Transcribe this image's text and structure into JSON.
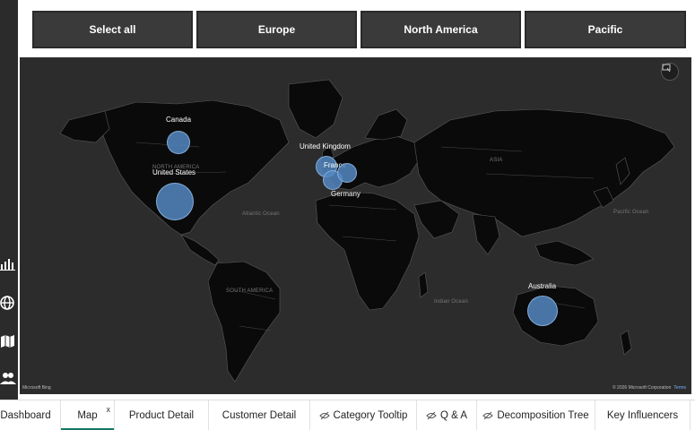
{
  "slicer": {
    "buttons": [
      "Select all",
      "Europe",
      "North America",
      "Pacific"
    ]
  },
  "map": {
    "bubbles": [
      {
        "label": "Canada"
      },
      {
        "label": "United States"
      },
      {
        "label": "United Kingdom"
      },
      {
        "label": "France"
      },
      {
        "label": "Germany"
      },
      {
        "label": "Australia"
      }
    ],
    "regions": {
      "north_america": "NORTH AMERICA",
      "atlantic": "Atlantic Ocean",
      "asia": "ASIA",
      "pacific": "Pacific Ocean",
      "south_america": "SOUTH AMERICA",
      "indian": "Indian Ocean"
    },
    "attribution_left": "Microsoft Bing",
    "attribution_right": "© 2026 Microsoft Corporation",
    "terms": "Terms",
    "bubble_color": "#5388c1",
    "background_color": "#2c2c2c"
  },
  "tabs": [
    {
      "label": "Dashboard"
    },
    {
      "label": "Map",
      "active": true,
      "close": "x"
    },
    {
      "label": "Product Detail"
    },
    {
      "label": "Customer Detail"
    },
    {
      "label": "Category Tooltip",
      "hidden": true
    },
    {
      "label": "Q & A",
      "hidden": true
    },
    {
      "label": "Decomposition Tree",
      "hidden": true
    },
    {
      "label": "Key Influencers"
    }
  ],
  "accent_color": "#117865",
  "nav_icons": [
    "bar-chart-icon",
    "globe-icon",
    "map-icon",
    "people-icon"
  ]
}
